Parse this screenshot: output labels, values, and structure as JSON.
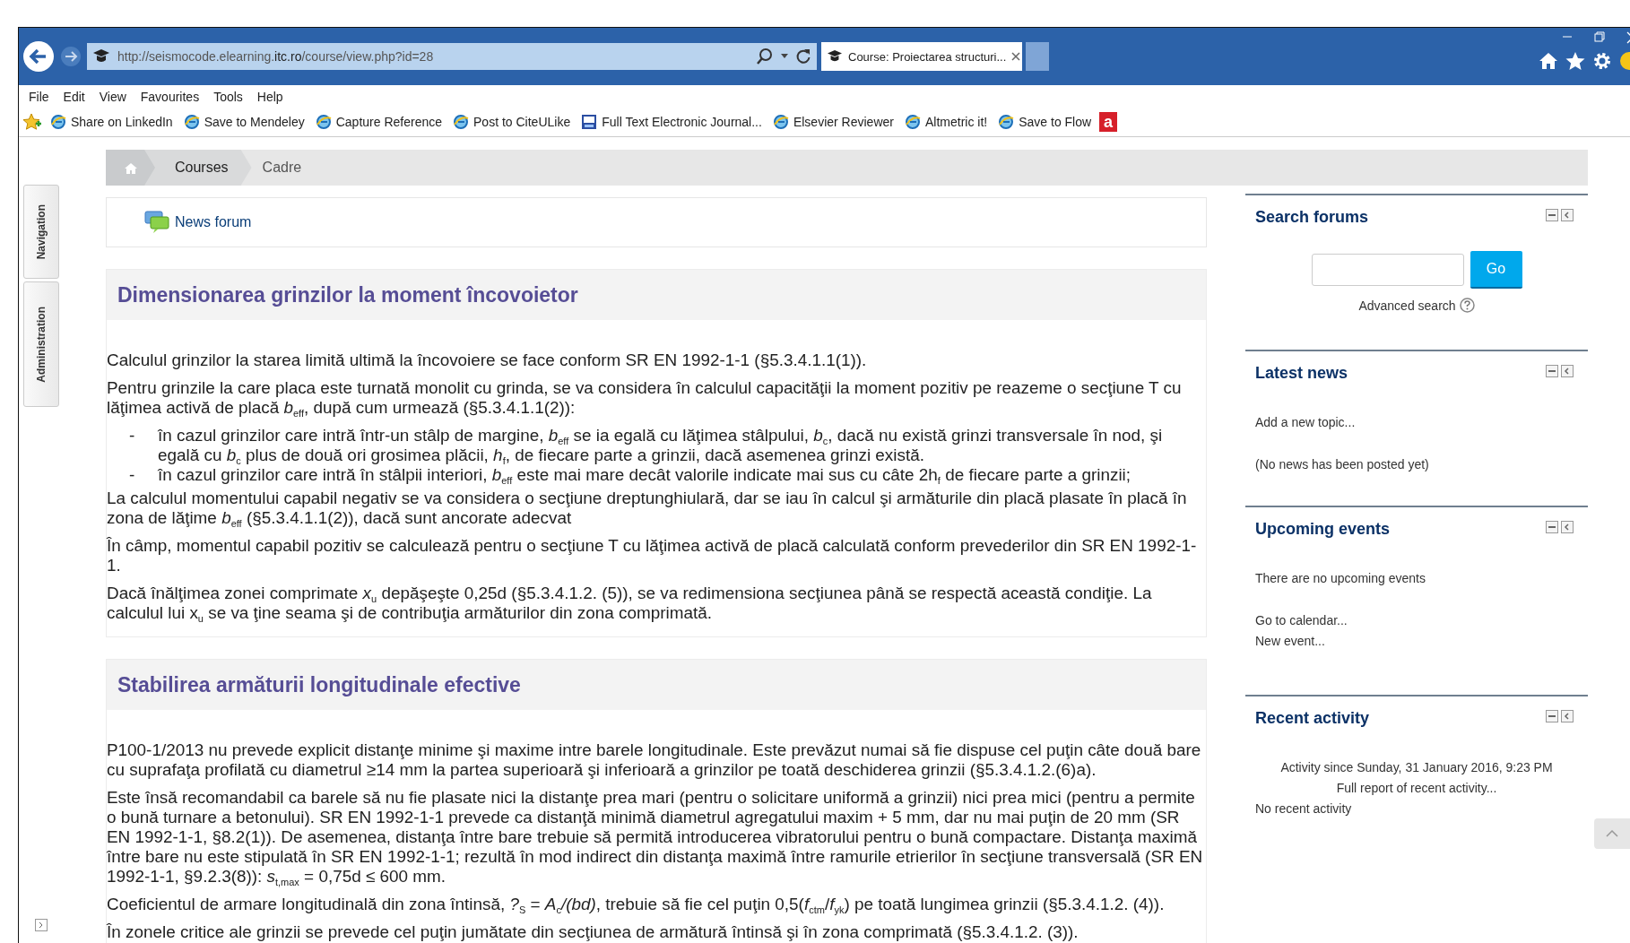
{
  "browser": {
    "address": "http://seismocode.elearning.**itc.ro**/course/view.php?id=28",
    "tab": {
      "title": "Course: Proiectarea structuri...",
      "selected": true
    },
    "menu": [
      "File",
      "Edit",
      "View",
      "Favourites",
      "Tools",
      "Help"
    ],
    "favourites": [
      {
        "kind": "ie",
        "label": "Share on LinkedIn"
      },
      {
        "kind": "ie",
        "label": "Save to Mendeley"
      },
      {
        "kind": "ie",
        "label": "Capture Reference"
      },
      {
        "kind": "ie",
        "label": "Post to CiteULike"
      },
      {
        "kind": "feed",
        "label": "Full Text Electronic Journal..."
      },
      {
        "kind": "ie",
        "label": "Elsevier Reviewer"
      },
      {
        "kind": "ie",
        "label": "Altmetric it!"
      },
      {
        "kind": "ie",
        "label": "Save to Flow"
      },
      {
        "kind": "badge",
        "label": "a"
      }
    ]
  },
  "dock": [
    "Navigation",
    "Administration"
  ],
  "breadcrumb": [
    "Courses",
    "Cadre"
  ],
  "news_forum": "News forum",
  "sections": [
    {
      "title": "Dimensionarea grinzilor la moment încovoietor",
      "paragraphs": [
        {
          "kind": "p",
          "text": "Calculul grinzilor la starea limită ultimă la încovoiere se face conform SR EN 1992-1-1 (§5.3.4.1.1(1))."
        },
        {
          "kind": "p",
          "text": "Pentru grinzile la care placa este turnată monolit cu grinda, se va considera în calculul capacităţii la moment pozitiv pe reazeme o secţiune T cu lăţimea activă de placă *b*$_{eff}$, după cum urmează (§5.3.4.1.1(2)):"
        },
        {
          "kind": "bullet",
          "marker": "-",
          "text": "în cazul grinzilor care intră într-un stâlp de margine, *b*$_{eff}$ se ia egală cu lăţimea stâlpului, *b*$_{c}$, dacă nu există grinzi transversale în nod, şi egală cu *b*$_{c}$ plus de două ori grosimea plăcii, *h*$_{f}$, de fiecare parte a grinzii, dacă asemenea grinzi există."
        },
        {
          "kind": "bullet",
          "marker": "-",
          "text": "în cazul grinzilor care intră în stâlpii interiori, *b*$_{eff}$ este mai mare decât valorile indicate mai sus cu câte 2h$_{f}$ de fiecare parte a grinzii;"
        },
        {
          "kind": "p",
          "text": "La calculul momentului capabil negativ se va considera o secţiune dreptunghiulară, dar se iau în calcul şi armăturile din placă plasate în placă în zona de lăţime *b*$_{eff}$  (§5.3.4.1.1(2)), dacă sunt ancorate adecvat"
        },
        {
          "kind": "p",
          "text": "În câmp, momentul capabil pozitiv se calculează pentru o secţiune T cu lăţimea activă de placă calculată conform prevederilor din SR EN 1992-1-1."
        },
        {
          "kind": "p",
          "text": "Dacă înălţimea zonei comprimate *x*$_{u}$ depăşeşte 0,25d (§5.3.4.1.2. (5)), se va redimensiona secţiunea până se respectă această condiţie. La calculul lui x$_{u}$ se va ţine seama şi de contribuţia armăturilor din zona comprimată."
        }
      ]
    },
    {
      "title": "Stabilirea armăturii longitudinale efective",
      "paragraphs": [
        {
          "kind": "p",
          "text": "P100-1/2013 nu prevede explicit distanţe minime şi maxime intre barele longitudinale. Este prevăzut numai să fie dispuse cel puţin câte două bare cu suprafaţa profilată cu diametrul ≥14 mm la partea superioară şi inferioară a grinzilor pe toată deschiderea grinzii (§5.3.4.1.2.(6)a)."
        },
        {
          "kind": "p",
          "text": "Este însă recomandabil ca barele să nu fie plasate nici la distanţe prea mari (pentru o solicitare uniformă a grinzii) nici prea mici (pentru a permite o bună turnare a betonului). SR EN 1992-1-1 prevede ca distanţă minimă diametrul agregatului maxim + 5 mm, dar nu mai puţin de 20 mm (SR EN 1992-1-1, §8.2(1)). De asemenea, distanţa între bare trebuie să permită introducerea vibratorului pentru o bună compactare. Distanţa maximă între bare nu este stipulată în SR EN 1992-1-1; rezultă în mod indirect din distanţa maximă între ramurile etrierilor în secţiune transversală (SR EN 1992-1-1, §9.2.3(8)): *s*$_{t,max}$ = 0,75d ≤ 600 mm."
        },
        {
          "kind": "p",
          "text": "Coeficientul de armare longitudinală din zona întinsă, *?*$_{S}$ = *A*$_{c}$*/(bd)*, trebuie să fie cel puţin 0,5(*f*$_{ctm}$/*f*$_{yk}$) pe toată lungimea grinzii (§5.3.4.1.2. (4))."
        },
        {
          "kind": "p",
          "text": "În zonele critice ale grinzii se prevede cel puţin jumătate din secţiunea de armătură întinsă şi în zona comprimată (§5.3.4.1.2. (3))."
        }
      ]
    }
  ],
  "blocks": [
    {
      "kind": "search",
      "title": "Search forums",
      "button": "Go",
      "link": "Advanced search"
    },
    {
      "kind": "list",
      "title": "Latest news",
      "groups": [
        [
          {
            "text": "Add a new topic...",
            "centered": false
          }
        ],
        [
          {
            "text": "(No news has been posted yet)",
            "centered": false
          }
        ]
      ]
    },
    {
      "kind": "list",
      "title": "Upcoming events",
      "groups": [
        [
          {
            "text": "There are no upcoming events",
            "centered": false
          }
        ],
        [
          {
            "text": "Go to calendar...",
            "centered": false
          },
          {
            "text": "New event...",
            "centered": false
          }
        ]
      ]
    },
    {
      "kind": "list",
      "title": "Recent activity",
      "groups": [
        [
          {
            "text": "Activity since Sunday, 31 January 2016, 9:23 PM",
            "centered": true
          },
          {
            "text": "Full report of recent activity...",
            "centered": true
          },
          {
            "text": "No recent activity",
            "centered": false
          }
        ]
      ]
    }
  ]
}
